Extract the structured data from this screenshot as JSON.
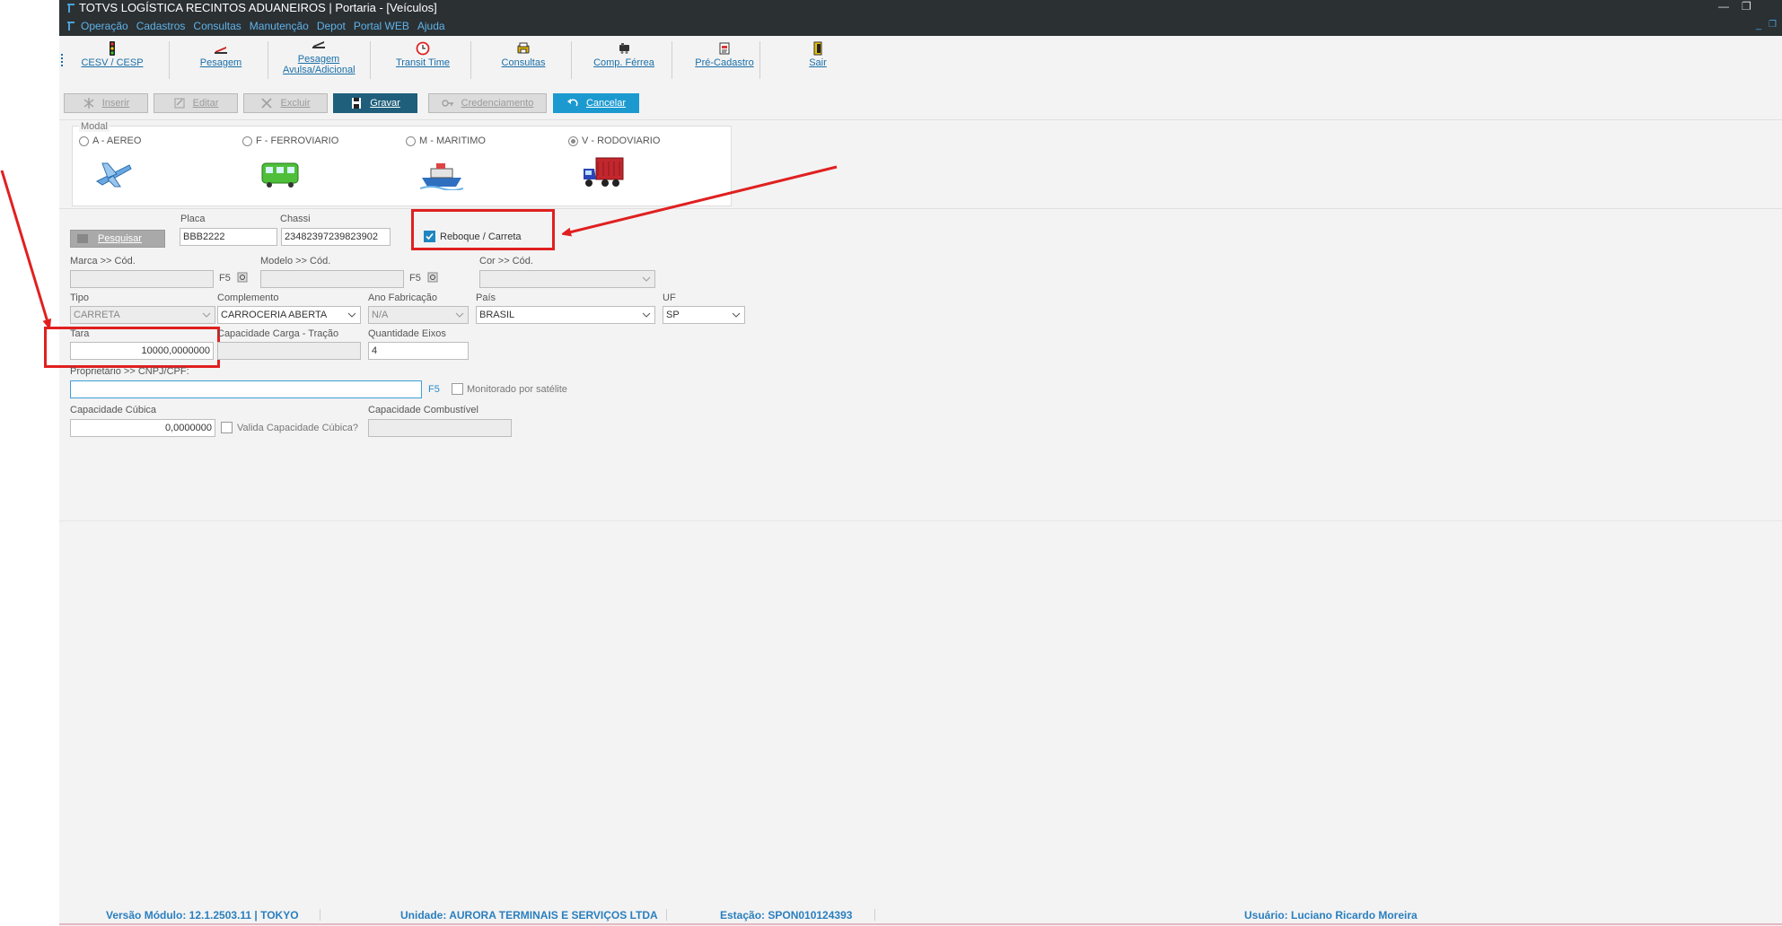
{
  "window": {
    "title": "TOTVS LOGÍSTICA RECINTOS ADUANEIROS | Portaria - [Veículos]",
    "menu": [
      "Operação",
      "Cadastros",
      "Consultas",
      "Manutenção",
      "Depot",
      "Portal WEB",
      "Ajuda"
    ]
  },
  "toolbar": {
    "items": [
      {
        "label": "CESV / CESP",
        "icon": "traffic-light-icon"
      },
      {
        "label": "Pesagem",
        "icon": "scale-icon"
      },
      {
        "label": "Pesagem Avulsa/Adicional",
        "icon": "scale-icon"
      },
      {
        "label": "Transit Time",
        "icon": "clock-icon"
      },
      {
        "label": "Consultas",
        "icon": "printer-icon"
      },
      {
        "label": "Comp. Férrea",
        "icon": "train-icon"
      },
      {
        "label": "Pré-Cadastro",
        "icon": "document-icon"
      },
      {
        "label": "Sair",
        "icon": "exit-door-icon"
      }
    ]
  },
  "actions": {
    "inserir": "Inserir",
    "editar": "Editar",
    "excluir": "Excluir",
    "gravar": "Gravar",
    "credenciamento": "Credenciamento",
    "cancelar": "Cancelar"
  },
  "modal": {
    "label": "Modal",
    "options": [
      {
        "label": "A - AEREO",
        "selected": false
      },
      {
        "label": "F - FERROVIARIO",
        "selected": false
      },
      {
        "label": "M - MARITIMO",
        "selected": false
      },
      {
        "label": "V - RODOVIARIO",
        "selected": true
      }
    ]
  },
  "form": {
    "pesquisar": "Pesquisar",
    "placa_label": "Placa",
    "placa_value": "BBB2222",
    "chassi_label": "Chassi",
    "chassi_value": "23482397239823902",
    "reboque_label": "Reboque / Carreta",
    "reboque_checked": true,
    "marca_label": "Marca >> Cód.",
    "modelo_label": "Modelo >> Cód.",
    "cor_label": "Cor >> Cód.",
    "f5": "F5",
    "tipo_label": "Tipo",
    "tipo_value": "CARRETA",
    "complemento_label": "Complemento",
    "complemento_value": "CARROCERIA ABERTA",
    "ano_label": "Ano Fabricação",
    "ano_value": "N/A",
    "pais_label": "País",
    "pais_value": "BRASIL",
    "uf_label": "UF",
    "uf_value": "SP",
    "tara_label": "Tara",
    "tara_value": "10000,0000000",
    "capacidade_carga_label": "Capacidade Carga - Tração",
    "eixos_label": "Quantidade Eixos",
    "eixos_value": "4",
    "proprietario_label": "Proprietário >> CNPJ/CPF:",
    "monitorado_label": "Monitorado por satélite",
    "cap_cubica_label": "Capacidade Cúbica",
    "cap_cubica_value": "0,0000000",
    "valida_cubica_label": "Valida Capacidade Cúbica?",
    "cap_combustivel_label": "Capacidade Combustível"
  },
  "status": {
    "versao": "Versão Módulo:  12.1.2503.11  |  TOKYO",
    "unidade": "Unidade: AURORA TERMINAIS E SERVIÇOS LTDA",
    "estacao": "Estação: SPON010124393",
    "usuario": "Usuário: Luciano Ricardo Moreira"
  },
  "colors": {
    "titlebar": "#2b3033",
    "accent": "#1c9ad0",
    "annotation": "#e02020"
  }
}
